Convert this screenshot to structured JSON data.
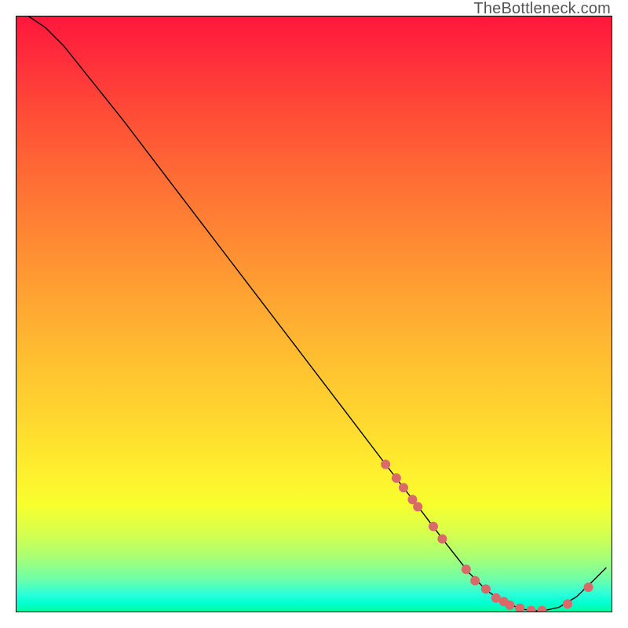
{
  "watermark": "TheBottleneck.com",
  "chart_data": {
    "type": "line",
    "title": "",
    "xlabel": "",
    "ylabel": "",
    "xlim": [
      0,
      100
    ],
    "ylim": [
      0,
      100
    ],
    "curve": [
      {
        "x": 2,
        "y": 100
      },
      {
        "x": 5,
        "y": 98
      },
      {
        "x": 8,
        "y": 95
      },
      {
        "x": 12,
        "y": 90
      },
      {
        "x": 18,
        "y": 82.5
      },
      {
        "x": 25,
        "y": 73.3
      },
      {
        "x": 35,
        "y": 60.2
      },
      {
        "x": 45,
        "y": 47.1
      },
      {
        "x": 55,
        "y": 34.0
      },
      {
        "x": 62,
        "y": 24.8
      },
      {
        "x": 67,
        "y": 18.3
      },
      {
        "x": 72,
        "y": 11.7
      },
      {
        "x": 76,
        "y": 6.6
      },
      {
        "x": 79,
        "y": 3.6
      },
      {
        "x": 82,
        "y": 1.6
      },
      {
        "x": 85,
        "y": 0.5
      },
      {
        "x": 88,
        "y": 0.2
      },
      {
        "x": 91,
        "y": 0.8
      },
      {
        "x": 94,
        "y": 2.6
      },
      {
        "x": 97,
        "y": 5.5
      },
      {
        "x": 99,
        "y": 7.5
      }
    ],
    "points": {
      "color": "#d86a6a",
      "radius": 6,
      "values": [
        {
          "x": 62.0,
          "y": 24.8
        },
        {
          "x": 63.8,
          "y": 22.5
        },
        {
          "x": 65.0,
          "y": 20.9
        },
        {
          "x": 66.5,
          "y": 18.9
        },
        {
          "x": 67.4,
          "y": 17.7
        },
        {
          "x": 70.0,
          "y": 14.4
        },
        {
          "x": 71.5,
          "y": 12.3
        },
        {
          "x": 75.5,
          "y": 7.2
        },
        {
          "x": 77.0,
          "y": 5.3
        },
        {
          "x": 78.8,
          "y": 3.9
        },
        {
          "x": 80.5,
          "y": 2.4
        },
        {
          "x": 81.8,
          "y": 1.8
        },
        {
          "x": 82.8,
          "y": 1.2
        },
        {
          "x": 84.5,
          "y": 0.7
        },
        {
          "x": 86.4,
          "y": 0.3
        },
        {
          "x": 88.2,
          "y": 0.3
        },
        {
          "x": 92.5,
          "y": 1.4
        },
        {
          "x": 96.0,
          "y": 4.2
        }
      ]
    }
  }
}
